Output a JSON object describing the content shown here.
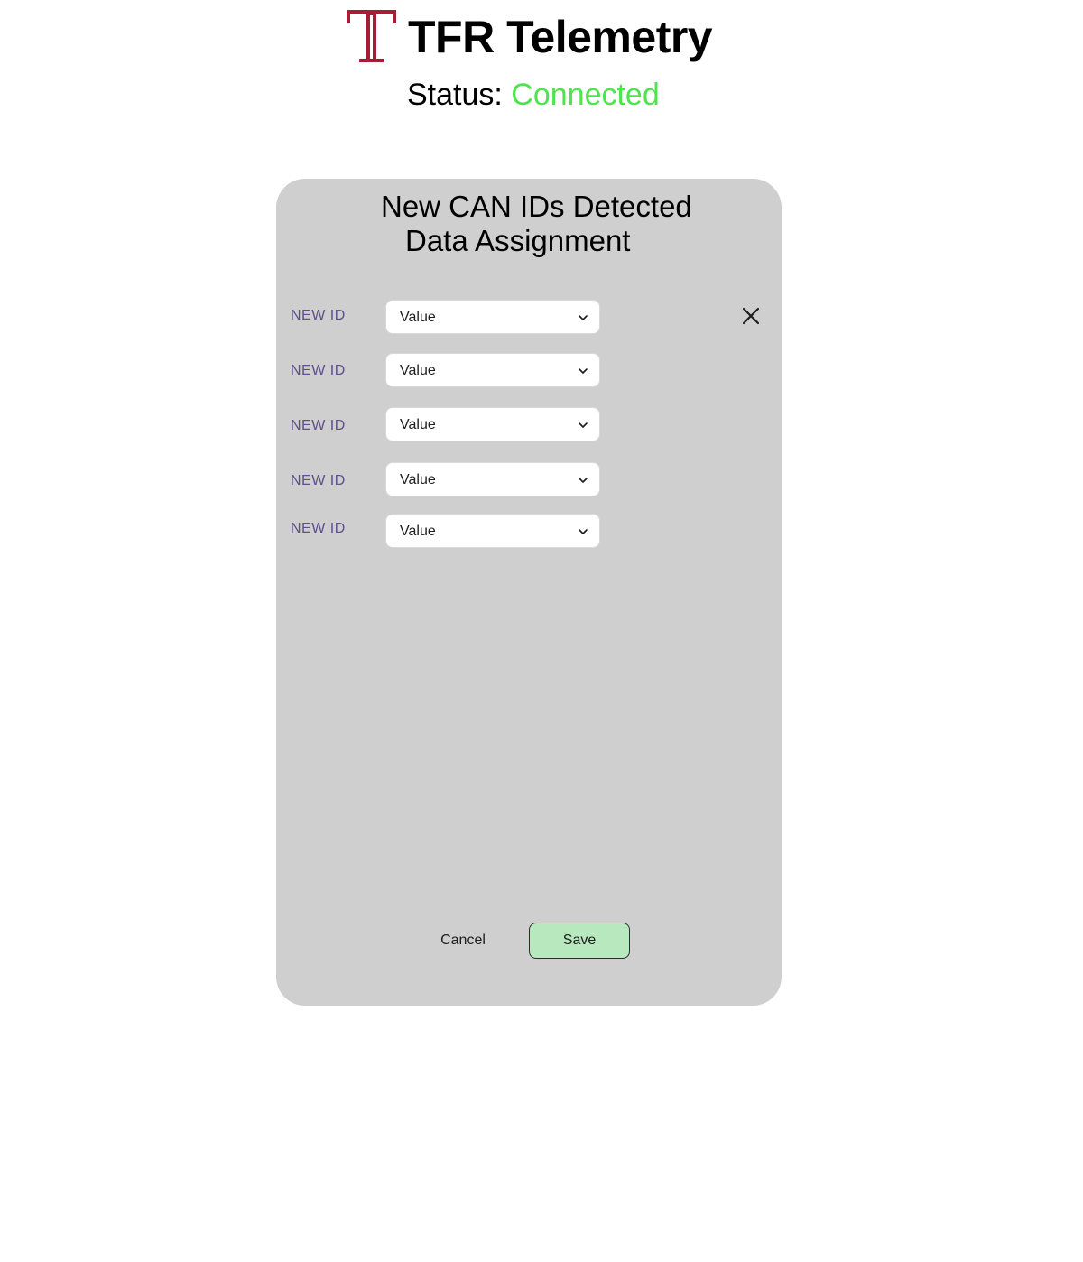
{
  "header": {
    "app_title": "TFR Telemetry",
    "status_label": "Status:",
    "status_value": "Connected",
    "logo_icon": "temple-t-logo",
    "colors": {
      "logo": "#a41e35",
      "status_ok": "#4ee44e"
    }
  },
  "dialog": {
    "title_line1": "New CAN IDs Detected",
    "title_line2": "Data Assignment",
    "close_icon": "close-icon",
    "background": "#cfcfcf",
    "rows": [
      {
        "label": "NEW ID",
        "value": "Value"
      },
      {
        "label": "NEW ID",
        "value": "Value"
      },
      {
        "label": "NEW ID",
        "value": "Value"
      },
      {
        "label": "NEW ID",
        "value": "Value"
      },
      {
        "label": "NEW ID",
        "value": "Value"
      }
    ],
    "cancel_label": "Cancel",
    "save_label": "Save",
    "save_color": "#b8e8bd"
  }
}
